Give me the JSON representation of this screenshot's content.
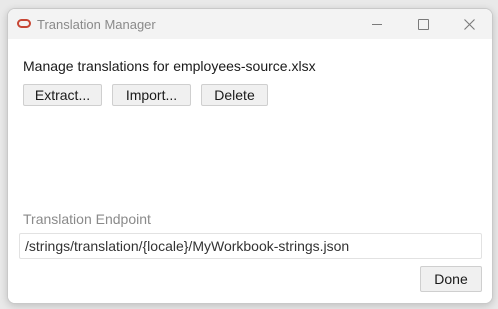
{
  "window": {
    "title": "Translation Manager"
  },
  "main": {
    "heading": "Manage translations for employees-source.xlsx",
    "buttons": {
      "extract": "Extract...",
      "import": "Import...",
      "delete": "Delete"
    },
    "endpoint": {
      "label": "Translation Endpoint",
      "value": "/strings/translation/{locale}/MyWorkbook-strings.json"
    },
    "done_label": "Done"
  },
  "icons": {
    "app": "oracle-logo-icon",
    "minimize": "minimize-icon",
    "maximize": "maximize-icon",
    "close": "close-icon"
  },
  "colors": {
    "brand": "#c74634",
    "titlebar": "#f3f3f3"
  }
}
